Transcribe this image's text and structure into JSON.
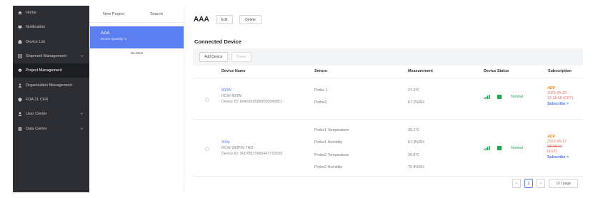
{
  "sidebar": {
    "items": [
      {
        "label": "Home",
        "icon": "home-icon",
        "chevron": false,
        "active": false
      },
      {
        "label": "Notification",
        "icon": "message-icon",
        "chevron": false,
        "active": false
      },
      {
        "label": "Device List",
        "icon": "device-icon",
        "chevron": false,
        "active": false
      },
      {
        "label": "Shipment Management",
        "icon": "shipment-icon",
        "chevron": true,
        "active": false
      },
      {
        "label": "Project Management",
        "icon": "project-icon",
        "chevron": false,
        "active": true
      },
      {
        "label": "Organization Management",
        "icon": "organization-icon",
        "chevron": false,
        "active": false
      },
      {
        "label": "FDA 21 CFR",
        "icon": "shield-icon",
        "chevron": false,
        "active": false
      },
      {
        "label": "User Center",
        "icon": "user-icon",
        "chevron": true,
        "active": false
      },
      {
        "label": "Data Center",
        "icon": "data-icon",
        "chevron": true,
        "active": false
      }
    ]
  },
  "project_list": {
    "new_label": "New Project",
    "search_label": "Search",
    "selected": {
      "name": "AAA",
      "quantity": "Device Quantity: 0"
    },
    "no_more": "No More"
  },
  "project": {
    "title": "AAA",
    "edit_label": "Edit",
    "delete_label": "Delete",
    "section_title": "Connected Device",
    "add_device_label": "Add Device",
    "power_label": "Power"
  },
  "table": {
    "headers": {
      "device_name": "Device Name",
      "sensor": "Sensor",
      "measurement": "Measurement",
      "device_status": "Device Status",
      "subscription": "Subscription"
    },
    "rows": [
      {
        "name": "800W",
        "model": "RCW-800W",
        "device_id": "Device ID: 80429095899050849851",
        "sensors": [
          "Probe 1",
          "Probe2"
        ],
        "measurements": [
          "27.3℃",
          "67.2%RH"
        ],
        "status": "Normal",
        "sub_type": "ADV",
        "sub_date_lines": [
          "2022-05-25",
          "16:18:58 (CST)"
        ],
        "subscribe_label": "Subscribe >"
      },
      {
        "name": "360p",
        "model": "RCW-360PW-THD",
        "device_id": "Device ID: 90078573985447718599",
        "sensors": [
          "Probe1 Temperature",
          "Probe1 Humidity",
          "Probe2 Temperature",
          "Probe2 Humidity"
        ],
        "measurements": [
          "25.1℃",
          "67.3%RH",
          "26.0℃",
          "70.4%RH"
        ],
        "status": "Normal",
        "sub_type": "ADV",
        "sub_date_lines": [
          "2022-05-17",
          "08:28:44",
          "(EST)"
        ],
        "subscribe_label": "Subscribe >"
      }
    ]
  },
  "pagination": {
    "prev": "<",
    "page": "1",
    "next": ">",
    "page_size": "10 / page"
  },
  "colors": {
    "sidebar_bg": "#2d2e33",
    "accent": "#5b7ff0",
    "normal_green": "#1aaa4e",
    "adv_orange": "#e88a2a",
    "date_red": "#f07070"
  }
}
